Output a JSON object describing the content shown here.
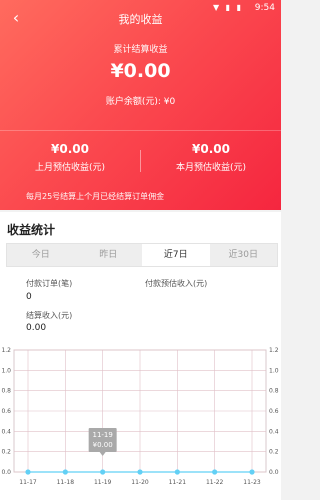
{
  "status": {
    "time": "9:54",
    "icons": "▼ ▮ ▮"
  },
  "header": {
    "title": "我的收益",
    "back_icon": "chevron-left-icon"
  },
  "summary": {
    "label": "累计结算收益",
    "amount": "¥0.00",
    "balance": "账户余额(元): ¥0",
    "last_month": {
      "value": "¥0.00",
      "label": "上月预估收益(元)"
    },
    "this_month": {
      "value": "¥0.00",
      "label": "本月预估收益(元)"
    },
    "note": "每月25号结算上个月已经结算订单佣金"
  },
  "stats": {
    "title": "收益统计",
    "tabs": [
      "今日",
      "昨日",
      "近7日",
      "近30日"
    ],
    "active_tab": 2,
    "metrics": {
      "orders_label": "付款订单(笔)",
      "orders_value": "0",
      "pay_est_label": "付款预估收入(元)",
      "settle_label": "结算收入(元)",
      "settle_value": "0.00"
    }
  },
  "chart_data": {
    "type": "line",
    "categories": [
      "11-17",
      "11-18",
      "11-19",
      "11-20",
      "11-21",
      "11-22",
      "11-23"
    ],
    "values": [
      0,
      0,
      0,
      0,
      0,
      0,
      0
    ],
    "ylim": [
      0,
      1.2
    ],
    "yticks": [
      "0.0",
      "0.2",
      "0.4",
      "0.6",
      "0.8",
      "1.0",
      "1.2"
    ],
    "grid": true,
    "tooltip": {
      "date": "11-19",
      "value": "¥0.00"
    },
    "colors": {
      "line": "#62d0f5",
      "grid": "#e0c0c8",
      "axis": "#d8c8cc"
    }
  }
}
